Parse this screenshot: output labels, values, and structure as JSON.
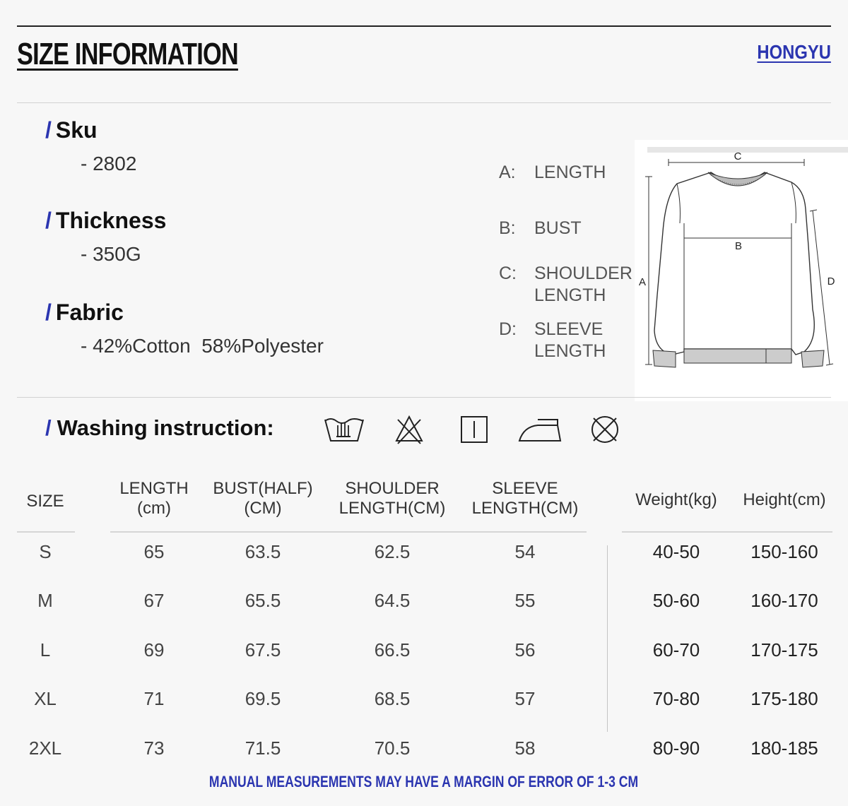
{
  "header": {
    "title": "SIZE INFORMATION",
    "brand": "HONGYU"
  },
  "specs": [
    {
      "label": "Sku",
      "value": "- 2802"
    },
    {
      "label": "Thickness",
      "value": "- 350G"
    },
    {
      "label": "Fabric",
      "value": "- 42%Cotton  58%Polyester"
    }
  ],
  "spec_slash": "/",
  "measurements": [
    {
      "key": "A:",
      "line1": "LENGTH",
      "line2": ""
    },
    {
      "key": "B:",
      "line1": "BUST",
      "line2": ""
    },
    {
      "key": "C:",
      "line1": "SHOULDER",
      "line2": "LENGTH"
    },
    {
      "key": "D:",
      "line1": "SLEEVE",
      "line2": "LENGTH"
    }
  ],
  "diagram": {
    "a": "A",
    "b": "B",
    "c": "C",
    "d": "D"
  },
  "washing": {
    "title": "Washing instruction:",
    "icons": [
      "hand-wash-icon",
      "no-bleach-icon",
      "line-dry-icon",
      "iron-icon",
      "no-dry-clean-icon"
    ]
  },
  "table": {
    "headers": {
      "size": "SIZE",
      "length": [
        "LENGTH",
        "(cm)"
      ],
      "bust": [
        "BUST(HALF)",
        "(CM)"
      ],
      "shoulder": [
        "SHOULDER",
        "LENGTH(CM)"
      ],
      "sleeve": [
        "SLEEVE",
        "LENGTH(CM)"
      ],
      "weight": "Weight(kg)",
      "height": "Height(cm)"
    },
    "rows": [
      {
        "size": "S",
        "length": "65",
        "bust": "63.5",
        "shoulder": "62.5",
        "sleeve": "54",
        "weight": "40-50",
        "height": "150-160"
      },
      {
        "size": "M",
        "length": "67",
        "bust": "65.5",
        "shoulder": "64.5",
        "sleeve": "55",
        "weight": "50-60",
        "height": "160-170"
      },
      {
        "size": "L",
        "length": "69",
        "bust": "67.5",
        "shoulder": "66.5",
        "sleeve": "56",
        "weight": "60-70",
        "height": "170-175"
      },
      {
        "size": "XL",
        "length": "71",
        "bust": "69.5",
        "shoulder": "68.5",
        "sleeve": "57",
        "weight": "70-80",
        "height": "175-180"
      },
      {
        "size": "2XL",
        "length": "73",
        "bust": "71.5",
        "shoulder": "70.5",
        "sleeve": "58",
        "weight": "80-90",
        "height": "180-185"
      }
    ]
  },
  "footnote": "MANUAL MEASUREMENTS MAY HAVE A MARGIN OF ERROR OF 1-3 CM",
  "colors": {
    "accent": "#2b35b0",
    "text": "#222222",
    "background": "#f7f7f7"
  }
}
